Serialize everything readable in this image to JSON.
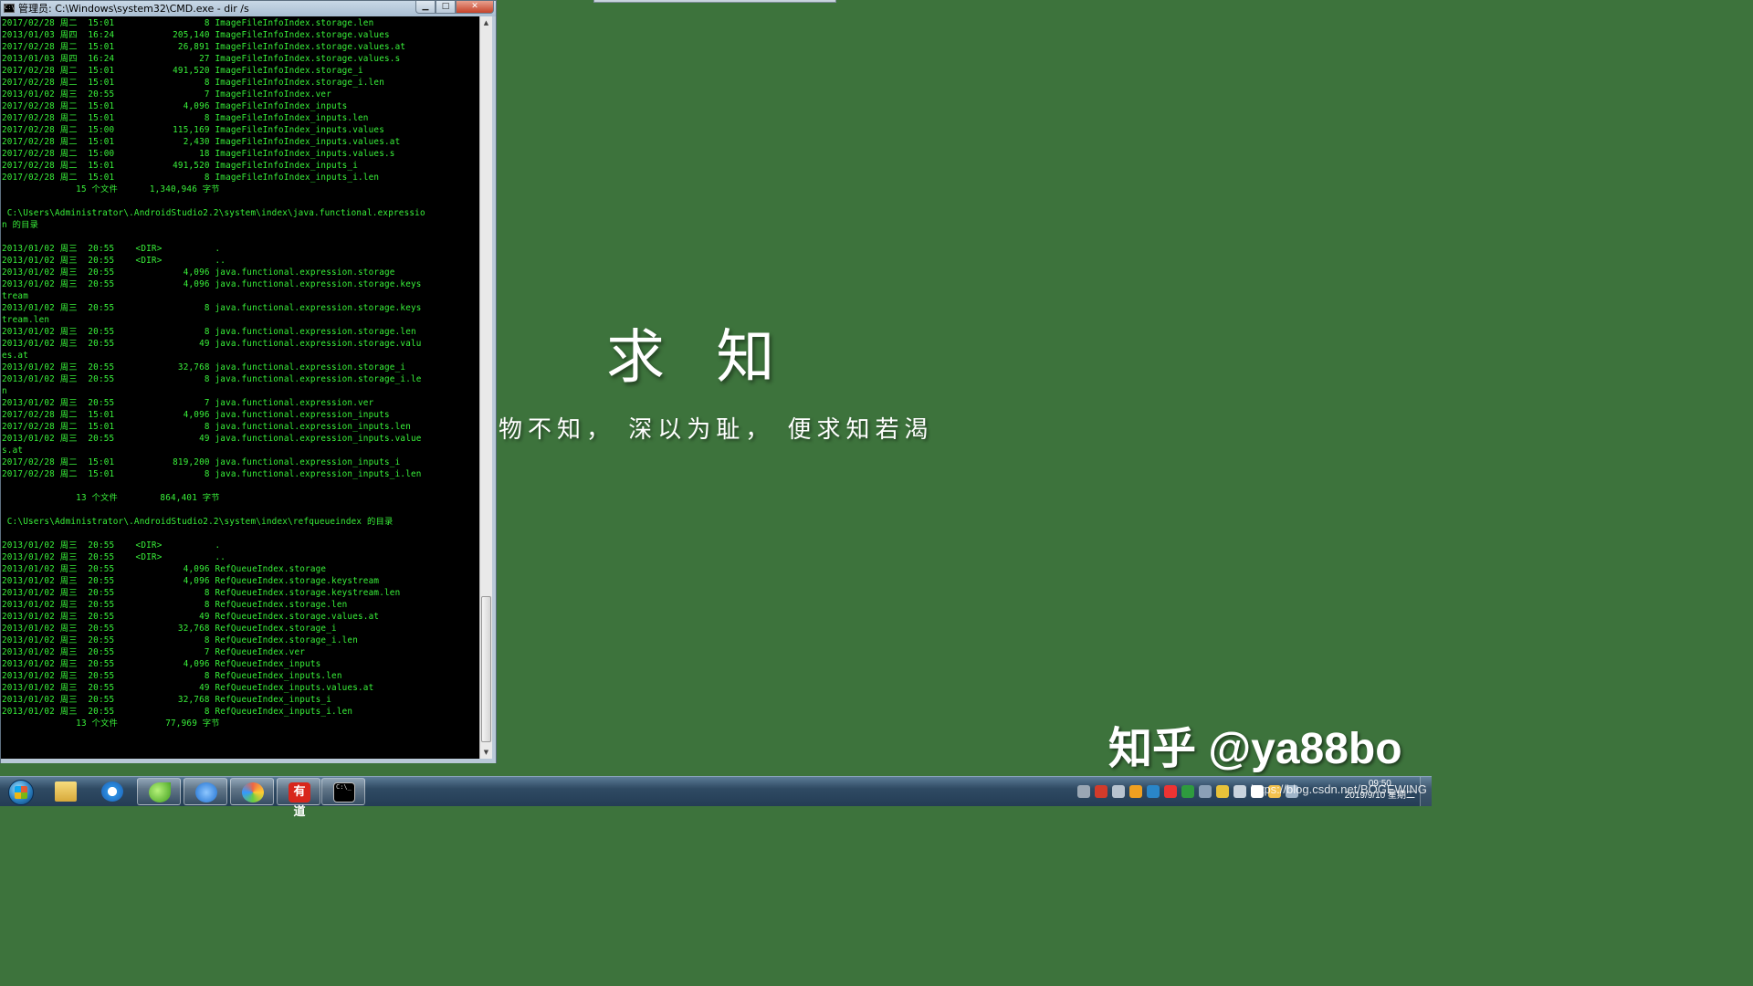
{
  "window": {
    "title": "管理员: C:\\Windows\\system32\\CMD.exe - dir /s",
    "minimize": "▁",
    "maximize": "□",
    "close": "✕"
  },
  "console": {
    "lines": [
      "2017/02/28 周二  15:01                 8 ImageFileInfoIndex.storage.len",
      "2013/01/03 周四  16:24           205,140 ImageFileInfoIndex.storage.values",
      "2017/02/28 周二  15:01            26,891 ImageFileInfoIndex.storage.values.at",
      "2013/01/03 周四  16:24                27 ImageFileInfoIndex.storage.values.s",
      "2017/02/28 周二  15:01           491,520 ImageFileInfoIndex.storage_i",
      "2017/02/28 周二  15:01                 8 ImageFileInfoIndex.storage_i.len",
      "2013/01/02 周三  20:55                 7 ImageFileInfoIndex.ver",
      "2017/02/28 周二  15:01             4,096 ImageFileInfoIndex_inputs",
      "2017/02/28 周二  15:01                 8 ImageFileInfoIndex_inputs.len",
      "2017/02/28 周二  15:00           115,169 ImageFileInfoIndex_inputs.values",
      "2017/02/28 周二  15:01             2,430 ImageFileInfoIndex_inputs.values.at",
      "2017/02/28 周二  15:00                18 ImageFileInfoIndex_inputs.values.s",
      "2017/02/28 周二  15:01           491,520 ImageFileInfoIndex_inputs_i",
      "2017/02/28 周二  15:01                 8 ImageFileInfoIndex_inputs_i.len",
      "              15 个文件      1,340,946 字节",
      "",
      " C:\\Users\\Administrator\\.AndroidStudio2.2\\system\\index\\java.functional.expressio",
      "n 的目录",
      "",
      "2013/01/02 周三  20:55    <DIR>          .",
      "2013/01/02 周三  20:55    <DIR>          ..",
      "2013/01/02 周三  20:55             4,096 java.functional.expression.storage",
      "2013/01/02 周三  20:55             4,096 java.functional.expression.storage.keys",
      "tream",
      "2013/01/02 周三  20:55                 8 java.functional.expression.storage.keys",
      "tream.len",
      "2013/01/02 周三  20:55                 8 java.functional.expression.storage.len",
      "2013/01/02 周三  20:55                49 java.functional.expression.storage.valu",
      "es.at",
      "2013/01/02 周三  20:55            32,768 java.functional.expression.storage_i",
      "2013/01/02 周三  20:55                 8 java.functional.expression.storage_i.le",
      "n",
      "2013/01/02 周三  20:55                 7 java.functional.expression.ver",
      "2017/02/28 周二  15:01             4,096 java.functional.expression_inputs",
      "2017/02/28 周二  15:01                 8 java.functional.expression_inputs.len",
      "2013/01/02 周三  20:55                49 java.functional.expression_inputs.value",
      "s.at",
      "2017/02/28 周二  15:01           819,200 java.functional.expression_inputs_i",
      "2017/02/28 周二  15:01                 8 java.functional.expression_inputs_i.len",
      "",
      "              13 个文件        864,401 字节",
      "",
      " C:\\Users\\Administrator\\.AndroidStudio2.2\\system\\index\\refqueueindex 的目录",
      "",
      "2013/01/02 周三  20:55    <DIR>          .",
      "2013/01/02 周三  20:55    <DIR>          ..",
      "2013/01/02 周三  20:55             4,096 RefQueueIndex.storage",
      "2013/01/02 周三  20:55             4,096 RefQueueIndex.storage.keystream",
      "2013/01/02 周三  20:55                 8 RefQueueIndex.storage.keystream.len",
      "2013/01/02 周三  20:55                 8 RefQueueIndex.storage.len",
      "2013/01/02 周三  20:55                49 RefQueueIndex.storage.values.at",
      "2013/01/02 周三  20:55            32,768 RefQueueIndex.storage_i",
      "2013/01/02 周三  20:55                 8 RefQueueIndex.storage_i.len",
      "2013/01/02 周三  20:55                 7 RefQueueIndex.ver",
      "2013/01/02 周三  20:55             4,096 RefQueueIndex_inputs",
      "2013/01/02 周三  20:55                 8 RefQueueIndex_inputs.len",
      "2013/01/02 周三  20:55                49 RefQueueIndex_inputs.values.at",
      "2013/01/02 周三  20:55            32,768 RefQueueIndex_inputs_i",
      "2013/01/02 周三  20:55                 8 RefQueueIndex_inputs_i.len",
      "              13 个文件         77,969 字节"
    ],
    "text_color": "#39f13a",
    "background": "#000000"
  },
  "wallpaper": {
    "title": "求 知",
    "subtitle": "物不知， 深以为耻， 便求知若渴",
    "background": "#3d733c"
  },
  "watermark": {
    "zhihu": "知乎 @ya88bo",
    "csdn": "https://blog.csdn.net/BOGEWING"
  },
  "taskbar": {
    "items": [
      {
        "name": "file-explorer",
        "icon": "folder-icon"
      },
      {
        "name": "internet-explorer",
        "icon": "ie-icon"
      },
      {
        "name": "green-app",
        "icon": "leaf-icon"
      },
      {
        "name": "sogou",
        "icon": "sogou-icon"
      },
      {
        "name": "paint",
        "icon": "paint-icon"
      },
      {
        "name": "youdao",
        "icon": "youdao-icon",
        "label": "有道"
      },
      {
        "name": "cmd",
        "icon": "cmd-icon",
        "label": "C:\\_",
        "active": true
      }
    ],
    "clock": {
      "time": "09:50",
      "date": "2019/9/10 星期二"
    }
  }
}
